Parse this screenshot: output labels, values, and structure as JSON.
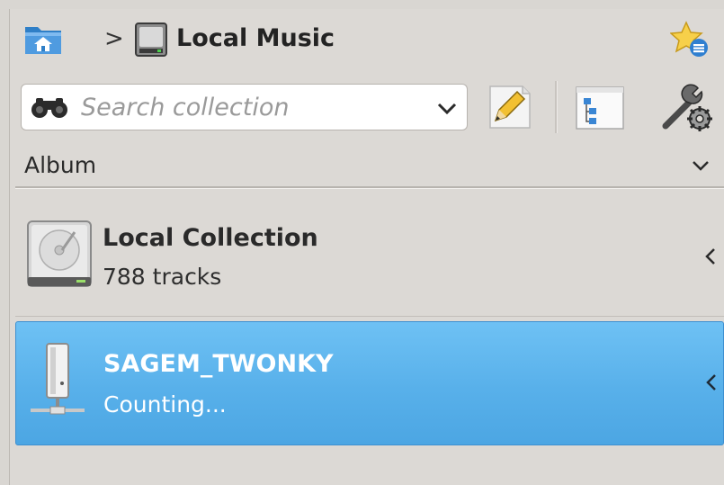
{
  "breadcrumb": {
    "home_icon": "home-folder-icon",
    "separator": ">",
    "current_icon": "music-disk-icon",
    "current_label": "Local Music",
    "favorite_icon": "star-bookmark-icon"
  },
  "toolbar": {
    "search": {
      "placeholder": "Search collection",
      "value": "",
      "icon": "binoculars-icon"
    },
    "edit_icon": "edit-filter-icon",
    "tree_icon": "tree-view-icon",
    "tools_icon": "tools-settings-icon"
  },
  "grouping": {
    "label": "Album"
  },
  "collections": [
    {
      "name": "Local Collection",
      "subtitle": "788 tracks",
      "icon": "hard-disk-icon",
      "selected": false
    },
    {
      "name": "SAGEM_TWONKY",
      "subtitle": "Counting...",
      "icon": "network-server-icon",
      "selected": true
    }
  ],
  "colors": {
    "panel_bg": "#dcd9d5",
    "selection": "#58b0ea",
    "selection_border": "#3d8fd0",
    "text": "#2a2a2a",
    "placeholder": "#9a9a9a"
  }
}
